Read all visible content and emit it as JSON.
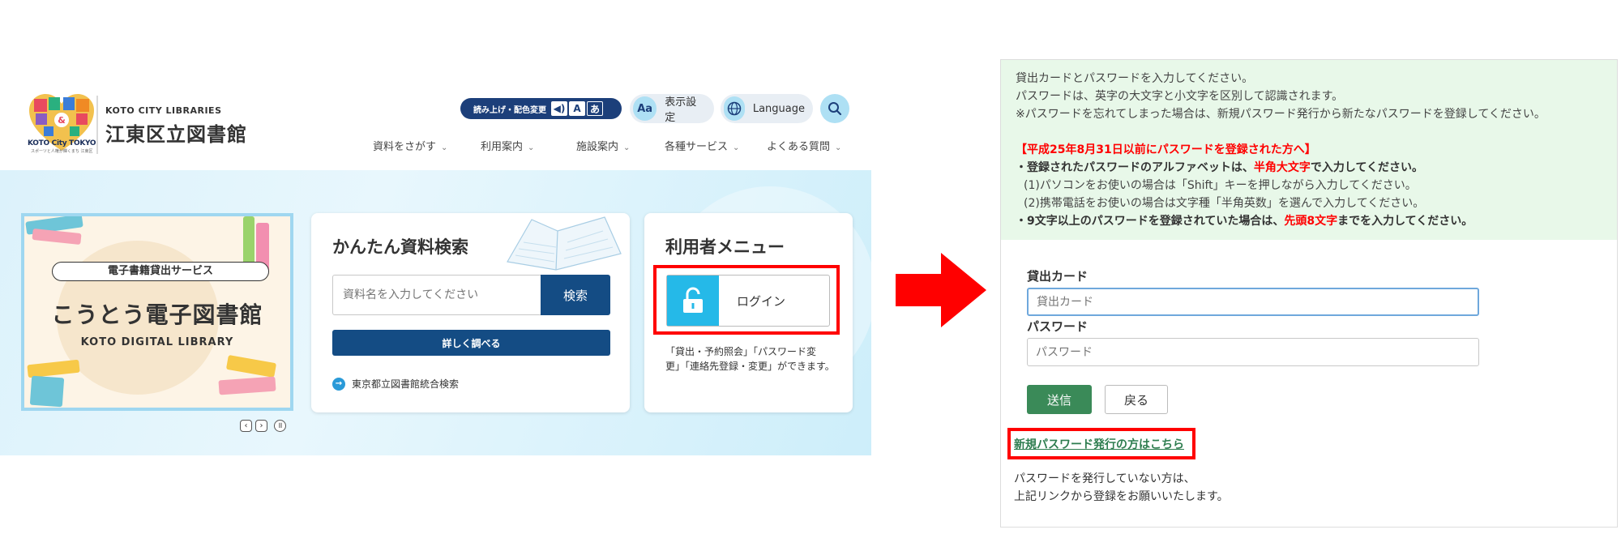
{
  "header": {
    "logo_text": "KOTO City TOKYO",
    "logo_sub": "スポーツと人権が輝くまち 江東区",
    "brand_en": "KOTO CITY LIBRARIES",
    "brand_jp": "江東区立図書館",
    "read_label": "読み上げ・配色変更",
    "display_settings": "表示設定",
    "language": "Language",
    "nav": [
      "資料をさがす",
      "利用案内",
      "施設案内",
      "各種サービス",
      "よくある質問"
    ]
  },
  "banner": {
    "tag": "電子書籍貸出サービス",
    "title": "こうとう電子図書館",
    "subtitle": "KOTO DIGITAL LIBRARY"
  },
  "search_card": {
    "title": "かんたん資料検索",
    "placeholder": "資料名を入力してください",
    "search_button": "検索",
    "detail_button": "詳しく調べる",
    "tokyo_link": "東京都立図書館統合検索"
  },
  "user_card": {
    "title": "利用者メニュー",
    "login_button": "ログイン",
    "description": "「貸出・予約照会」「パスワード変更」「連絡先登録・変更」ができます。"
  },
  "notice": {
    "line1": "貸出カードとパスワードを入力してください。",
    "line2": "パスワードは、英字の大文字と小文字を区別して認識されます。",
    "line3": "※パスワードを忘れてしまった場合は、新規パスワード発行から新たなパスワードを登録してください。",
    "heading": "【平成25年8月31日以前にパスワードを登録された方へ】",
    "rule1_pre": "・登録されたパスワードのアルファベットは、",
    "rule1_red": "半角大文字",
    "rule1_post": "で入力してください。",
    "sub1": "(1)パソコンをお使いの場合は「Shift」キーを押しながら入力してください。",
    "sub2": "(2)携帯電話をお使いの場合は文字種「半角英数」を選んで入力してください。",
    "rule2_pre": "・9文字以上のパスワードを登録されていた場合は、",
    "rule2_red": "先頭8文字",
    "rule2_post": "までを入力してください。"
  },
  "form": {
    "card_label": "貸出カード",
    "card_placeholder": "貸出カード",
    "password_label": "パスワード",
    "password_placeholder": "パスワード",
    "submit": "送信",
    "back": "戻る",
    "new_password_link": "新規パスワード発行の方はこちら",
    "footer_line1": "パスワードを発行していない方は、",
    "footer_line2": "上記リンクから登録をお願いいたします。"
  },
  "colors": {
    "navy": "#144c84",
    "highlight_red": "#ff0000",
    "login_blue": "#25b9e8",
    "form_green": "#3a8a58",
    "notice_bg": "#e8f8e9"
  }
}
